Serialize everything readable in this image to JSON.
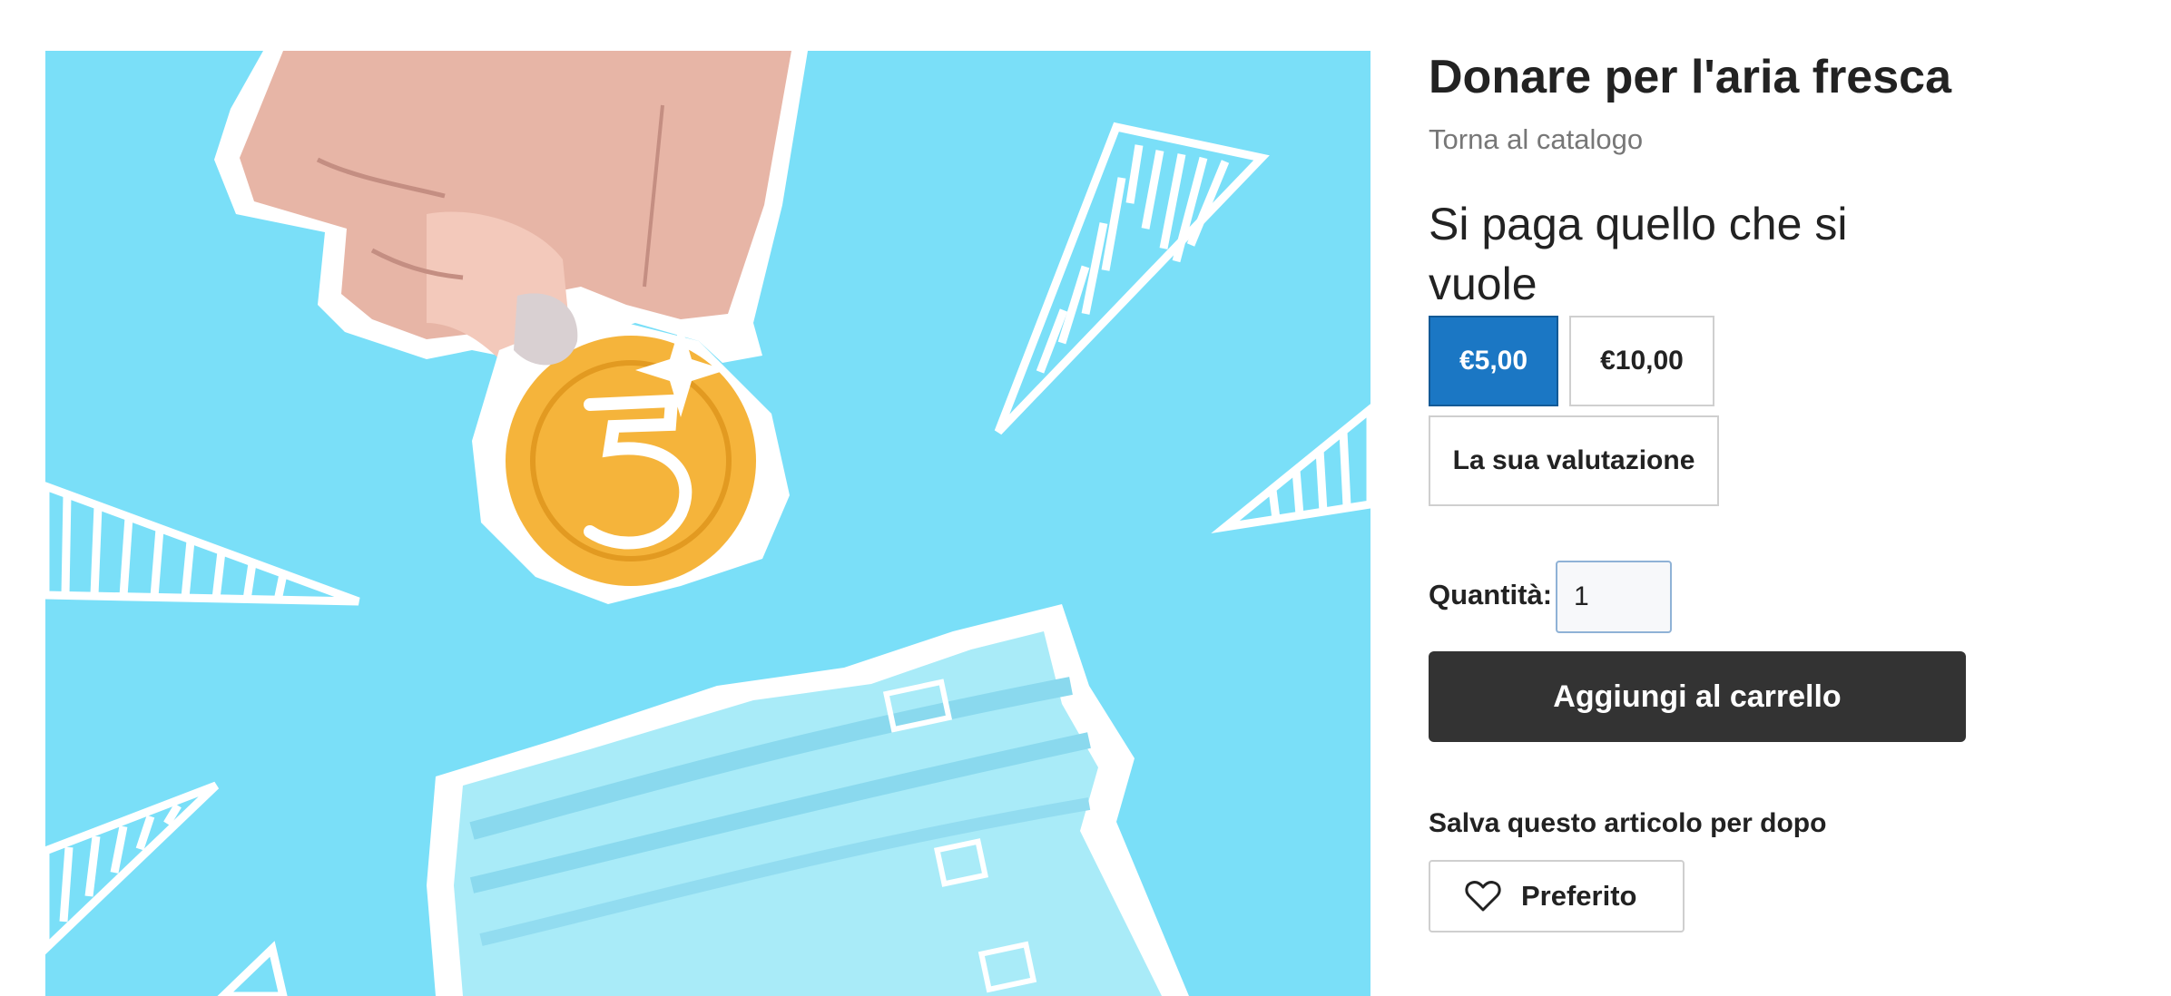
{
  "product": {
    "title": "Donare per l'aria fresca",
    "back_link": "Torna al catalogo",
    "image_icon": "donation-jar-coin-illustration"
  },
  "pricing": {
    "heading": "Si paga quello che si vuole",
    "options": [
      {
        "label": "€5,00",
        "selected": true
      },
      {
        "label": "€10,00",
        "selected": false
      },
      {
        "label": "La sua valutazione",
        "selected": false
      }
    ]
  },
  "quantity": {
    "label": "Quantità:",
    "value": "1"
  },
  "cart": {
    "add_label": "Aggiungi al carrello"
  },
  "save": {
    "label": "Salva questo articolo per dopo",
    "favorite_label": "Preferito",
    "favorite_icon": "heart-icon"
  },
  "colors": {
    "accent": "#1b77c4",
    "cart_button": "#333333",
    "image_background": "#7adff8"
  }
}
